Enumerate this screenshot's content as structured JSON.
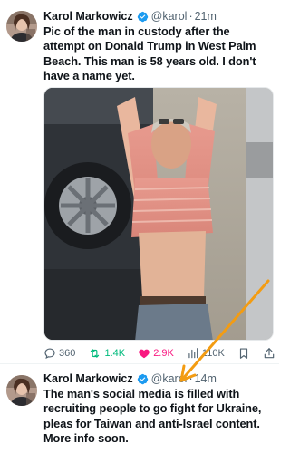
{
  "tweets": [
    {
      "author": {
        "display_name": "Karol Markowicz",
        "handle": "@karol",
        "verified": true,
        "avatar_icon": "profile-photo-avatar"
      },
      "separator": "·",
      "timestamp": "21m",
      "text": "Pic of the man in custody after the attempt on Donald Trump in West Palm Beach. This man is 58 years old. I don't have a name yet.",
      "media": {
        "type": "photo",
        "description_icon": "photo-icon"
      },
      "actions": {
        "reply": {
          "icon": "reply-icon",
          "count": "360"
        },
        "retweet": {
          "icon": "retweet-icon",
          "count": "1.4K",
          "color": "#00ba7c"
        },
        "like": {
          "icon": "heart-icon",
          "count": "2.9K",
          "color": "#f91880"
        },
        "views": {
          "icon": "views-icon",
          "count": "110K"
        },
        "bookmark": {
          "icon": "bookmark-icon"
        },
        "share": {
          "icon": "share-icon"
        }
      }
    },
    {
      "author": {
        "display_name": "Karol Markowicz",
        "handle": "@karol",
        "verified": true,
        "avatar_icon": "profile-photo-avatar"
      },
      "separator": "·",
      "timestamp": "14m",
      "text": "The man's social media is filled with recruiting people to go fight for Ukraine, pleas for Taiwan and anti-Israel content. More info soon."
    }
  ],
  "colors": {
    "verified_badge": "#1d9bf0",
    "annotation_arrow": "#f39c12",
    "secondary_text": "#536471"
  }
}
